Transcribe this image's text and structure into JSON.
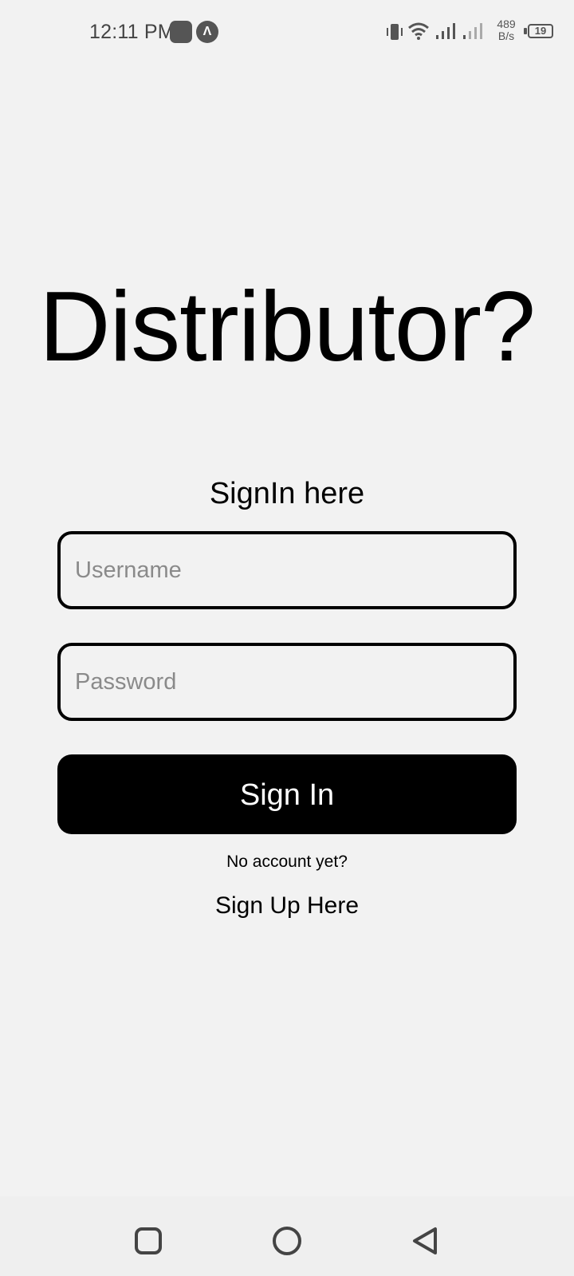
{
  "status_bar": {
    "time": "12:11 PM",
    "notification_glyph": "Λ",
    "net_speed_value": "489",
    "net_speed_unit": "B/s",
    "battery": "19"
  },
  "main": {
    "title": "Distributor?",
    "subtitle": "SignIn here",
    "username_placeholder": "Username",
    "password_placeholder": "Password",
    "signin_label": "Sign In",
    "no_account_text": "No account yet?",
    "signup_label": "Sign Up Here"
  },
  "nav_bar": {
    "icons": [
      "recent-apps-icon",
      "home-icon",
      "back-icon"
    ]
  },
  "colors": {
    "background": "#f2f2f2",
    "primary": "#000000",
    "button_text": "#ffffff",
    "placeholder": "#8a8a8a"
  }
}
